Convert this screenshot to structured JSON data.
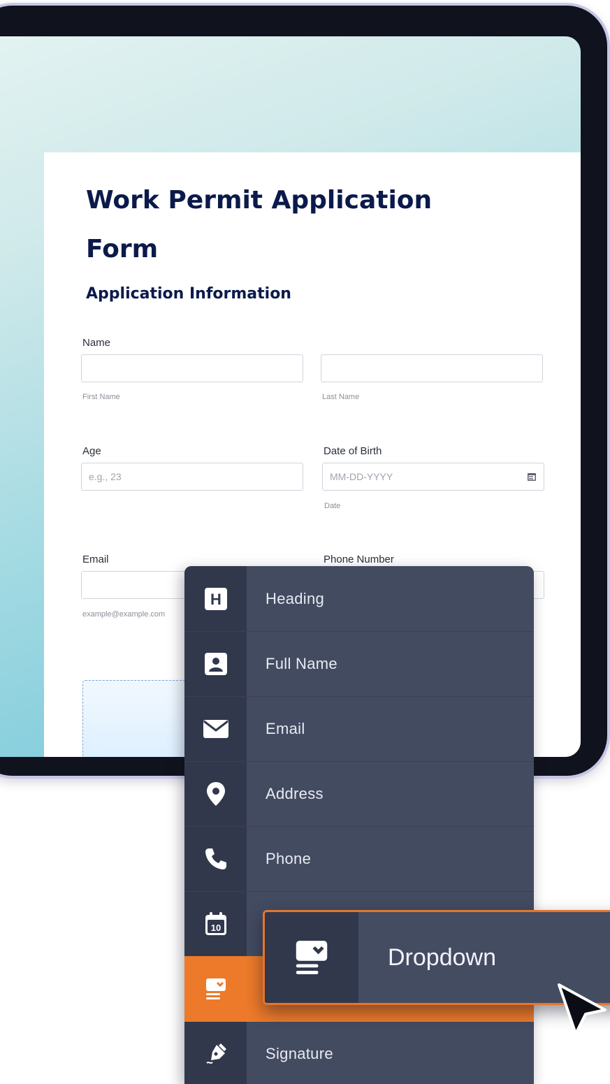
{
  "form": {
    "title": "Work Permit Application Form",
    "section": "Application Information",
    "fields": {
      "name_label": "Name",
      "first_name_sub": "First Name",
      "last_name_sub": "Last Name",
      "age_label": "Age",
      "age_placeholder": "e.g., 23",
      "dob_label": "Date of Birth",
      "dob_placeholder": "MM-DD-YYYY",
      "dob_sub": "Date",
      "email_label": "Email",
      "email_sub": "example@example.com",
      "phone_label": "Phone Number"
    }
  },
  "menu": {
    "items": [
      {
        "label": "Heading",
        "icon": "heading-icon"
      },
      {
        "label": "Full Name",
        "icon": "contact-card-icon"
      },
      {
        "label": "Email",
        "icon": "envelope-icon"
      },
      {
        "label": "Address",
        "icon": "map-pin-icon"
      },
      {
        "label": "Phone",
        "icon": "phone-icon"
      },
      {
        "label": "",
        "icon": "calendar-icon"
      },
      {
        "label": "",
        "icon": "dropdown-icon",
        "active": true
      },
      {
        "label": "Signature",
        "icon": "pen-icon"
      }
    ],
    "calendar_icon_text": "10",
    "heading_icon_text": "H"
  },
  "drag_card": {
    "label": "Dropdown",
    "icon": "dropdown-icon"
  },
  "colors": {
    "title": "#0b1a4b",
    "menu_bg": "#434b61",
    "menu_icon_col": "#31384c",
    "accent": "#ec7a2a"
  }
}
